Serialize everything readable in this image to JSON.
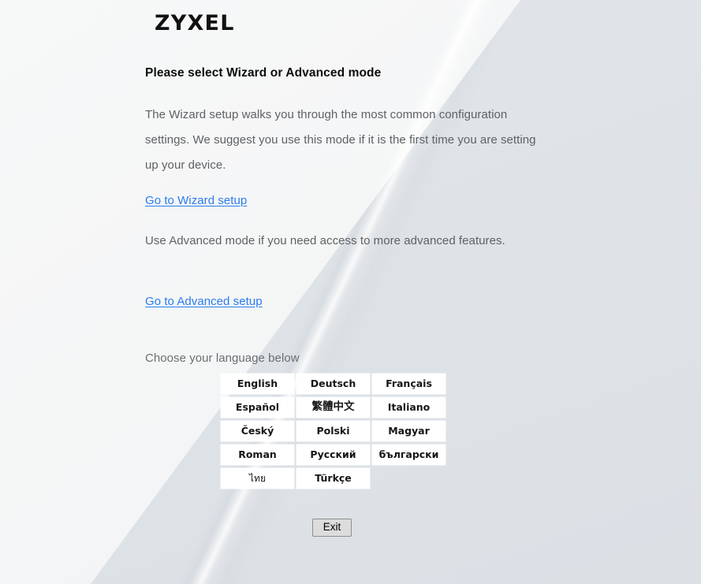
{
  "brand": {
    "logo_text": "ZYXEL"
  },
  "page": {
    "heading": "Please select Wizard or Advanced mode",
    "wizard_paragraph": "The Wizard setup walks you through the most common configuration settings. We suggest you use this mode if it is the first time you are setting up your device.",
    "wizard_link": "Go to Wizard setup",
    "advanced_paragraph": "Use Advanced mode if you need access to more advanced features.",
    "advanced_link": "Go to Advanced setup",
    "language_label": "Choose your language below"
  },
  "languages": [
    {
      "label": "English",
      "name": "english"
    },
    {
      "label": "Deutsch",
      "name": "deutsch"
    },
    {
      "label": "Français",
      "name": "francais"
    },
    {
      "label": "Español",
      "name": "espanol"
    },
    {
      "label": "繁體中文",
      "name": "traditional-chinese"
    },
    {
      "label": "Italiano",
      "name": "italiano"
    },
    {
      "label": "Český",
      "name": "cesky"
    },
    {
      "label": "Polski",
      "name": "polski"
    },
    {
      "label": "Magyar",
      "name": "magyar"
    },
    {
      "label": "Roman",
      "name": "roman"
    },
    {
      "label": "Русский",
      "name": "russian"
    },
    {
      "label": "български",
      "name": "bulgarian"
    },
    {
      "label": "ไทย",
      "name": "thai"
    },
    {
      "label": "Türkçe",
      "name": "turkce"
    }
  ],
  "footer": {
    "exit_label": "Exit"
  },
  "colors": {
    "link": "#2b7cf0",
    "heading": "#0d0d0d",
    "body_text": "#5f6164",
    "panel_left": "#f5f6f7",
    "panel_right": "#dee3e7",
    "button_face": "#ffffff",
    "exit_face": "#dcdcdc"
  }
}
